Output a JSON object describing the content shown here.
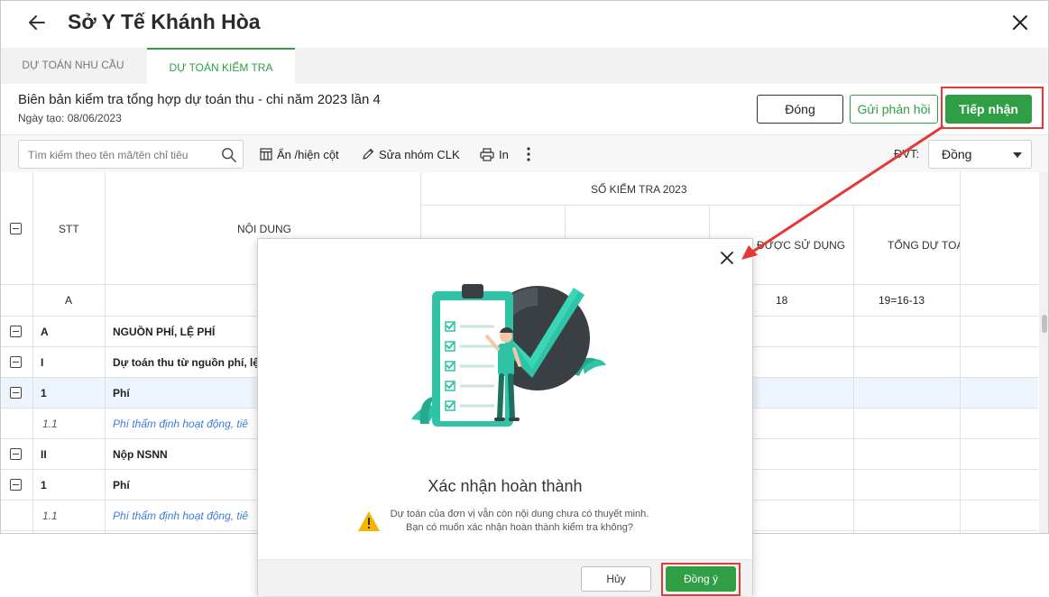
{
  "window": {
    "title": "Sở Y Tế Khánh Hòa",
    "back_icon": "arrow-left-icon",
    "close_icon": "close-icon"
  },
  "tabs": [
    {
      "label": "DỰ TOÁN NHU CẦU",
      "active": false
    },
    {
      "label": "DỰ TOÁN KIỂM TRA",
      "active": true
    }
  ],
  "document": {
    "title": "Biên bản kiểm tra tổng hợp dự toán thu - chi năm 2023 lần 4",
    "date": "Ngày tạo: 08/06/2023"
  },
  "actions": {
    "close_label": "Đóng",
    "feedback_label": "Gửi phản hồi",
    "accept_label": "Tiếp nhận"
  },
  "toolbar": {
    "search_placeholder": "Tìm kiếm theo tên mã/tên chỉ tiêu",
    "toggle_columns_label": "Ẩn /hiện cột",
    "edit_group_label": "Sửa nhóm CLK",
    "print_label": "In",
    "unit_label": "ĐVT:",
    "unit_value": "Đồng"
  },
  "table": {
    "headers": {
      "stt": "STT",
      "content": "NỘI DUNG",
      "group": "SỐ KIỂM TRA 2023",
      "used": "ĐƯỢC SỬ DỤNG",
      "total": "TỔNG DỰ TOÁN"
    },
    "index_row": {
      "stt": "A",
      "used": "18",
      "total": "19=16-13"
    },
    "rows": [
      {
        "stt": "A",
        "content": "NGUỒN PHÍ, LỆ PHÍ",
        "style": "bold",
        "toggle": true
      },
      {
        "stt": "I",
        "content": "Dự toán thu từ nguồn phí, lệ",
        "style": "bold",
        "toggle": true
      },
      {
        "stt": "1",
        "content": "Phí",
        "style": "bold",
        "toggle": true,
        "selected": true
      },
      {
        "stt": "1.1",
        "content": "Phí thẩm định hoạt động, tiê",
        "style": "italic",
        "toggle": false
      },
      {
        "stt": "II",
        "content": "Nộp NSNN",
        "style": "bold",
        "toggle": true
      },
      {
        "stt": "1",
        "content": "Phí",
        "style": "bold",
        "toggle": true
      },
      {
        "stt": "1.1",
        "content": "Phí thẩm định hoạt động, tiê",
        "style": "italic",
        "toggle": false
      }
    ]
  },
  "modal": {
    "title": "Xác nhận hoàn thành",
    "message_line1": "Dự toán của đơn vị vẫn còn nội dung chưa có thuyết minh.",
    "message_line2": "Bạn có muốn xác nhận hoàn thành kiểm tra không?",
    "cancel_label": "Hủy",
    "confirm_label": "Đồng ý",
    "warning_icon": "warning-icon",
    "close_icon": "close-icon"
  },
  "colors": {
    "brand_green": "#2f9e45",
    "highlight_red": "#e53935",
    "link_blue": "#3b7dd8",
    "teal_illustration": "#2ec4a5"
  }
}
